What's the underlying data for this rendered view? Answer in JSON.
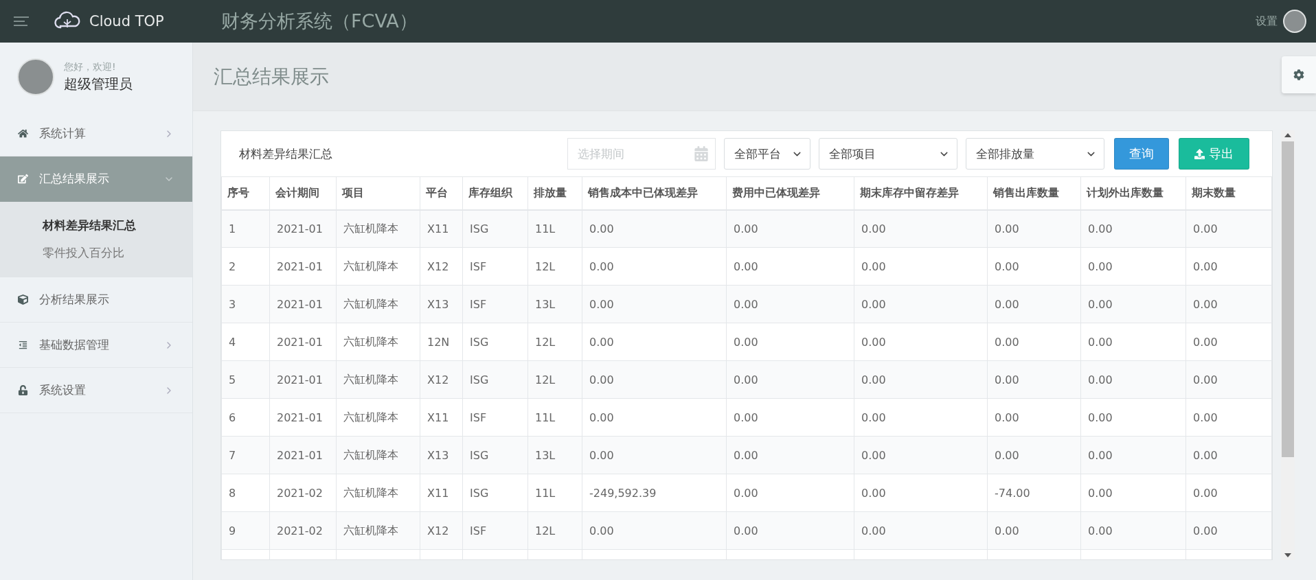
{
  "topbar": {
    "brand": "Cloud TOP",
    "title": "财务分析系统（FCVA）",
    "settings": "设置"
  },
  "user": {
    "greeting": "您好，欢迎!",
    "name": "超级管理员"
  },
  "sidebar": {
    "items": [
      {
        "label": "系统计算",
        "expanded": false,
        "selected": false,
        "has_arrow": true
      },
      {
        "label": "汇总结果展示",
        "expanded": true,
        "selected": true,
        "has_arrow": true,
        "children": [
          {
            "label": "材料差异结果汇总",
            "selected": true
          },
          {
            "label": "零件投入百分比",
            "selected": false
          }
        ]
      },
      {
        "label": "分析结果展示",
        "expanded": false,
        "selected": false,
        "has_arrow": false
      },
      {
        "label": "基础数据管理",
        "expanded": false,
        "selected": false,
        "has_arrow": true
      },
      {
        "label": "系统设置",
        "expanded": false,
        "selected": false,
        "has_arrow": true
      }
    ]
  },
  "page_title": "汇总结果展示",
  "card": {
    "title": "材料差异结果汇总",
    "period": {
      "placeholder": "选择期间"
    },
    "selects": [
      "全部平台",
      "全部项目",
      "全部排放量"
    ],
    "query_button": "查询",
    "export_button": "导出"
  },
  "table": {
    "columns": [
      "序号",
      "会计期间",
      "项目",
      "平台",
      "库存组织",
      "排放量",
      "销售成本中已体现差异",
      "费用中已体现差异",
      "期末库存中留存差异",
      "销售出库数量",
      "计划外出库数量",
      "期末数量"
    ],
    "rows": [
      [
        "1",
        "2021-01",
        "六缸机降本",
        "X11",
        "ISG",
        "11L",
        "0.00",
        "0.00",
        "0.00",
        "0.00",
        "0.00",
        "0.00"
      ],
      [
        "2",
        "2021-01",
        "六缸机降本",
        "X12",
        "ISF",
        "12L",
        "0.00",
        "0.00",
        "0.00",
        "0.00",
        "0.00",
        "0.00"
      ],
      [
        "3",
        "2021-01",
        "六缸机降本",
        "X13",
        "ISF",
        "13L",
        "0.00",
        "0.00",
        "0.00",
        "0.00",
        "0.00",
        "0.00"
      ],
      [
        "4",
        "2021-01",
        "六缸机降本",
        "12N",
        "ISG",
        "12L",
        "0.00",
        "0.00",
        "0.00",
        "0.00",
        "0.00",
        "0.00"
      ],
      [
        "5",
        "2021-01",
        "六缸机降本",
        "X12",
        "ISG",
        "12L",
        "0.00",
        "0.00",
        "0.00",
        "0.00",
        "0.00",
        "0.00"
      ],
      [
        "6",
        "2021-01",
        "六缸机降本",
        "X11",
        "ISF",
        "11L",
        "0.00",
        "0.00",
        "0.00",
        "0.00",
        "0.00",
        "0.00"
      ],
      [
        "7",
        "2021-01",
        "六缸机降本",
        "X13",
        "ISG",
        "13L",
        "0.00",
        "0.00",
        "0.00",
        "0.00",
        "0.00",
        "0.00"
      ],
      [
        "8",
        "2021-02",
        "六缸机降本",
        "X11",
        "ISG",
        "11L",
        "-249,592.39",
        "0.00",
        "0.00",
        "-74.00",
        "0.00",
        "0.00"
      ],
      [
        "9",
        "2021-02",
        "六缸机降本",
        "X12",
        "ISF",
        "12L",
        "0.00",
        "0.00",
        "0.00",
        "0.00",
        "0.00",
        "0.00"
      ]
    ]
  }
}
